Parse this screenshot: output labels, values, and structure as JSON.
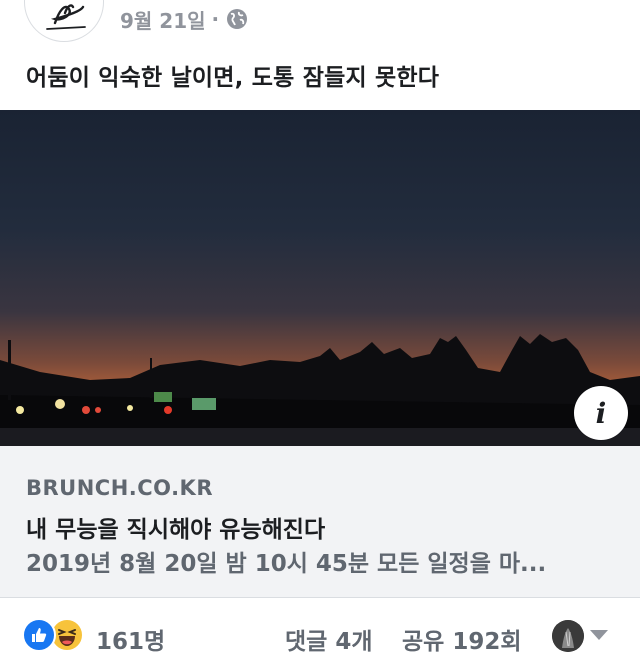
{
  "post": {
    "date": "9월 21일",
    "separator": "·",
    "privacy_icon": "globe-icon",
    "text": "어둠이 익숙한 날이면, 도통 잠들지 못한다"
  },
  "link_preview": {
    "domain": "BRUNCH.CO.KR",
    "title": "내 무능을 직시해야 유능해진다",
    "description": "2019년 8월 20일 밤 10시 45분 모든 일정을 마...",
    "info_icon_glyph": "i"
  },
  "reactions": {
    "icons": [
      "like-icon",
      "haha-icon"
    ],
    "count": "161명",
    "comments": "댓글 4개",
    "shares": "공유 192회"
  },
  "colors": {
    "like_blue": "#1877f2",
    "haha_yellow": "#f7c33b",
    "secondary_text": "#606770",
    "link_box_bg": "#f2f3f5"
  }
}
